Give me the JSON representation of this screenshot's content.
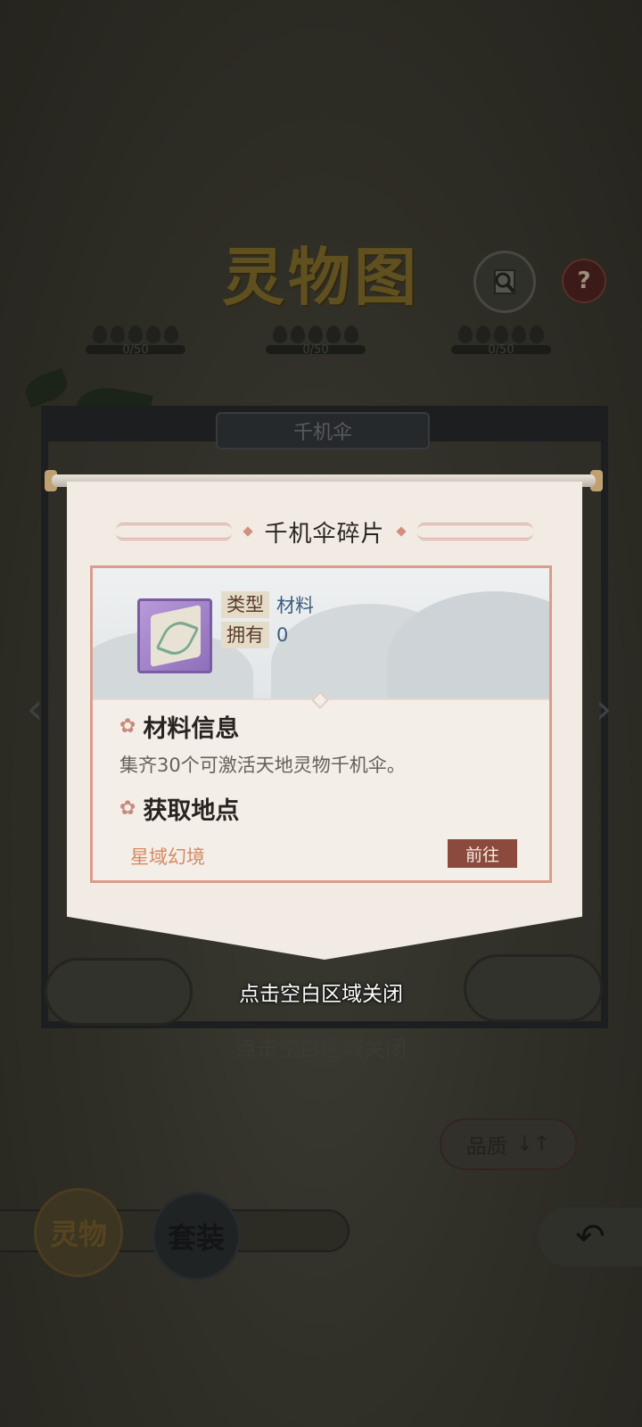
{
  "background": {
    "logo_text": "灵物图",
    "help_label": "?",
    "progress": [
      {
        "label": "0/50"
      },
      {
        "label": "0/50"
      },
      {
        "label": "0/50"
      }
    ],
    "scroll_banner_title": "千机伞",
    "ghost_progress": "0/50",
    "ghost_close_hint": "点击空白区域关闭",
    "sort_button_label": "品质",
    "sort_icon": "↓↑",
    "tabs": [
      {
        "label": "灵物",
        "active": true
      },
      {
        "label": "套装",
        "active": false
      }
    ],
    "back_icon": "↶",
    "prev_arrow": "‹",
    "next_arrow": "›"
  },
  "dialog": {
    "title": "千机伞碎片",
    "item": {
      "type_label": "类型",
      "type_value": "材料",
      "owned_label": "拥有",
      "owned_value": "0",
      "icon": "umbrella-fragment-icon",
      "rarity_color": "#9a7bc7"
    },
    "material_info_title": "材料信息",
    "material_info_text": "集齐30个可激活天地灵物千机伞。",
    "source_title": "获取地点",
    "sources": [
      {
        "name": "星域幻境",
        "button_label": "前往"
      }
    ]
  },
  "close_hint": "点击空白区域关闭",
  "colors": {
    "accent": "#8b4a3d",
    "source_text": "#d48a64",
    "frame": "#dc9c8c",
    "value_text": "#3d5d7d"
  }
}
